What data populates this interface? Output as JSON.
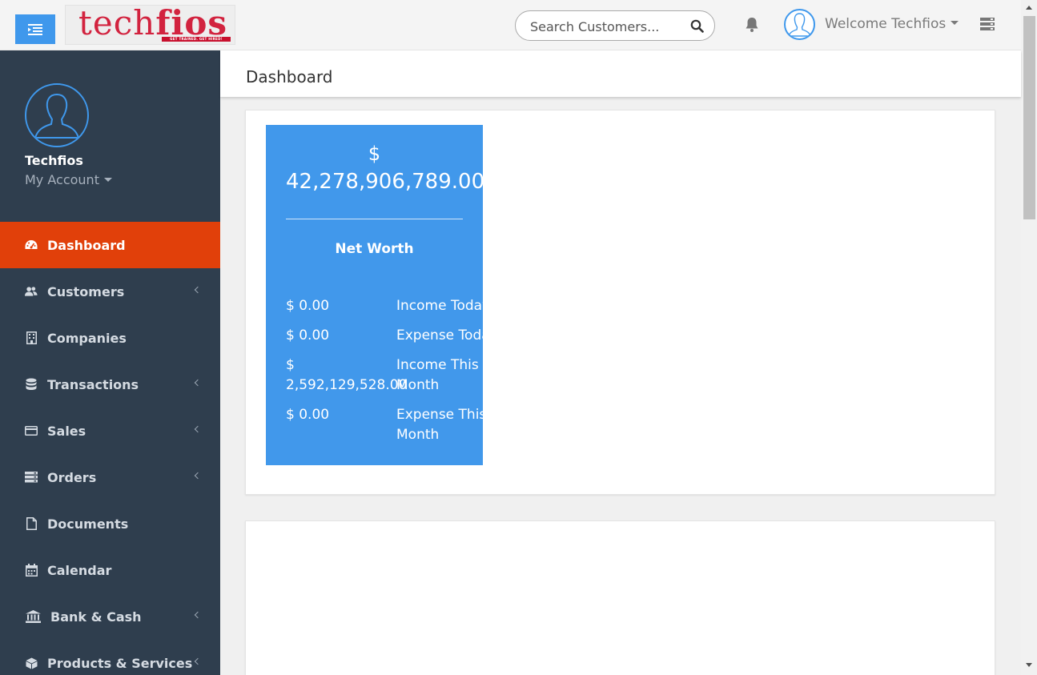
{
  "header": {
    "logo_text_part1": "tech",
    "logo_text_part2": "fios",
    "logo_tagline": "GET TRAINED. GET HIRED!",
    "search": {
      "placeholder": "Search Customers..."
    },
    "welcome_text": "Welcome Techfios",
    "icons": {
      "menu_toggle": "sidebar-toggle-icon",
      "search": "search-icon",
      "notifications": "bell-icon",
      "user": "user-avatar-icon",
      "right_menu": "server-icon"
    }
  },
  "sidebar": {
    "profile_name": "Techfios",
    "account_label": "My Account",
    "items": [
      {
        "label": "Dashboard",
        "icon": "dashboard-icon",
        "active": true,
        "has_submenu": false
      },
      {
        "label": "Customers",
        "icon": "users-icon",
        "active": false,
        "has_submenu": true
      },
      {
        "label": "Companies",
        "icon": "building-icon",
        "active": false,
        "has_submenu": false
      },
      {
        "label": "Transactions",
        "icon": "database-icon",
        "active": false,
        "has_submenu": true
      },
      {
        "label": "Sales",
        "icon": "credit-card-icon",
        "active": false,
        "has_submenu": true
      },
      {
        "label": "Orders",
        "icon": "server-icon",
        "active": false,
        "has_submenu": true
      },
      {
        "label": "Documents",
        "icon": "file-icon",
        "active": false,
        "has_submenu": false
      },
      {
        "label": "Calendar",
        "icon": "calendar-icon",
        "active": false,
        "has_submenu": false
      },
      {
        "label": "Bank & Cash",
        "icon": "bank-icon",
        "active": false,
        "has_submenu": true
      },
      {
        "label": "Products & Services",
        "icon": "cube-icon",
        "active": false,
        "has_submenu": true
      }
    ]
  },
  "main": {
    "page_title": "Dashboard",
    "net_worth_card": {
      "currency": "$",
      "amount": "42,278,906,789.00",
      "label": "Net Worth",
      "rows": [
        {
          "value": "$ 0.00",
          "label": "Income Today"
        },
        {
          "value": "$ 0.00",
          "label": "Expense Today"
        },
        {
          "value": "$ 2,592,129,528.00",
          "label": "Income This Month"
        },
        {
          "value": "$ 0.00",
          "label": "Expense This Month"
        }
      ]
    }
  },
  "colors": {
    "sidebar_bg": "#2f3e4e",
    "active_item": "#e1400a",
    "accent_blue": "#3f98ec",
    "card_blue": "#4198eb",
    "logo_red": "#d2233f"
  }
}
